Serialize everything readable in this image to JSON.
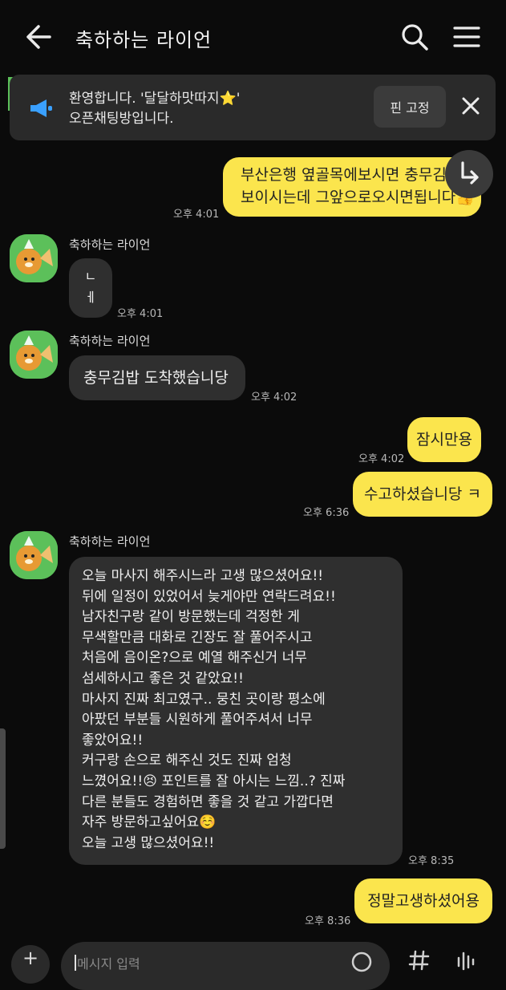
{
  "header": {
    "title": "축하하는 라이언",
    "back_icon": "arrow-left-icon",
    "search_icon": "search-icon",
    "menu_icon": "hamburger-menu-icon"
  },
  "notice": {
    "line1": "환영합니다. '달달하맛따지⭐'",
    "line2": "오픈채팅방입니다.",
    "pin_label": "핀 고정",
    "close_icon": "close-icon",
    "megaphone_icon": "megaphone-icon"
  },
  "sender_name": "축하하는 라이언",
  "messages": [
    {
      "side": "mine",
      "lines": [
        "부산은행 옆골목에보시면 충무김밥",
        "보이시는데 그앞으로오시면됩니다👍"
      ],
      "time": "오후 4:01"
    },
    {
      "side": "theirs",
      "lines": [
        "ㄴ",
        "ㅔ"
      ],
      "time": "오후 4:01"
    },
    {
      "side": "theirs",
      "lines": [
        "충무김밥 도착했습니당"
      ],
      "time": "오후 4:02"
    },
    {
      "side": "mine",
      "lines": [
        "잠시만용"
      ],
      "time": "오후 4:02"
    },
    {
      "side": "mine",
      "lines": [
        "수고하셨습니당 ㅋ"
      ],
      "time": "오후 6:36"
    },
    {
      "side": "theirs",
      "lines": [
        "오늘 마사지 해주시느라 고생 많으셨어요!!",
        "뒤에 일정이 있었어서 늦게야만 연락드려요!!",
        "남자친구랑 같이 방문했는데 걱정한 게",
        "무색할만큼 대화로 긴장도 잘 풀어주시고",
        "처음에 음이온?으로 예열 해주신거 너무",
        "섬세하시고 좋은 것 같았요!!",
        "마사지 진짜 최고였구.. 뭉친 곳이랑 평소에",
        "아팠던 부분들 시원하게 풀어주셔서 너무",
        "좋았어요!!",
        "커구랑 손으로 해주신 것도 진짜 엄청",
        "느꼈어요!!😣 포인트를 잘 아시는 느낌..? 진짜",
        "다른 분들도 경험하면 좋을 것 같고 가깝다면",
        "자주 방문하고싶어요☺️",
        "오늘 고생 많으셨어요!!"
      ],
      "time": "오후 8:35"
    },
    {
      "side": "mine",
      "lines": [
        "정말고생하셨어용"
      ],
      "time": "오후 8:36"
    }
  ],
  "input": {
    "placeholder": "메시지 입력",
    "plus_icon": "plus-icon",
    "emoji_icon": "emoji-icon",
    "hash_icon": "hash-icon",
    "voice_icon": "voice-icon"
  },
  "colors": {
    "background": "#0b0b0b",
    "mine_bubble": "#fbe54d",
    "theirs_bubble": "#2f2f2f",
    "notice_bg": "#2a2a2a",
    "megaphone": "#3aa0ff"
  }
}
